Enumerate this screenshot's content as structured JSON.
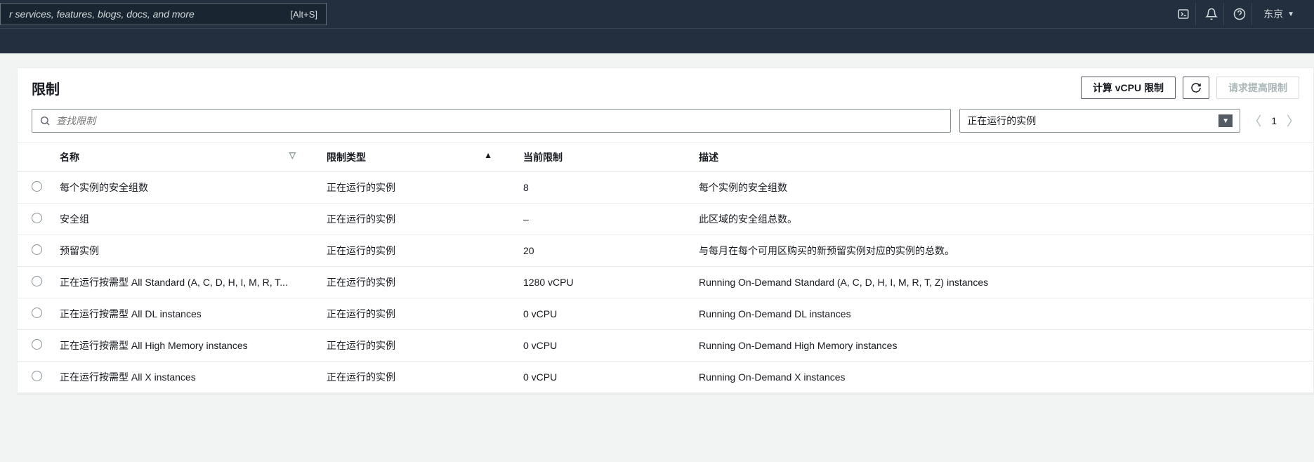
{
  "nav": {
    "search_placeholder": "r services, features, blogs, docs, and more",
    "search_hint": "[Alt+S]",
    "region": "东京"
  },
  "panel": {
    "title": "限制",
    "actions": {
      "compute_vcpu_label": "计算 vCPU 限制",
      "request_increase_label": "请求提高限制"
    }
  },
  "filter": {
    "search_placeholder": "查找限制",
    "dropdown_selected": "正在运行的实例"
  },
  "pagination": {
    "current": "1"
  },
  "table": {
    "headers": {
      "name": "名称",
      "limit_type": "限制类型",
      "current_limit": "当前限制",
      "description": "描述"
    },
    "rows": [
      {
        "name": "每个实例的安全组数",
        "limit_type": "正在运行的实例",
        "current_limit": "8",
        "description": "每个实例的安全组数"
      },
      {
        "name": "安全组",
        "limit_type": "正在运行的实例",
        "current_limit": "–",
        "description": "此区域的安全组总数。"
      },
      {
        "name": "预留实例",
        "limit_type": "正在运行的实例",
        "current_limit": "20",
        "description": "与每月在每个可用区购买的新预留实例对应的实例的总数。"
      },
      {
        "name": "正在运行按需型 All Standard (A, C, D, H, I, M, R, T...",
        "limit_type": "正在运行的实例",
        "current_limit": "1280 vCPU",
        "description": "Running On-Demand Standard (A, C, D, H, I, M, R, T, Z) instances"
      },
      {
        "name": "正在运行按需型 All DL instances",
        "limit_type": "正在运行的实例",
        "current_limit": "0 vCPU",
        "description": "Running On-Demand DL instances"
      },
      {
        "name": "正在运行按需型 All High Memory instances",
        "limit_type": "正在运行的实例",
        "current_limit": "0 vCPU",
        "description": "Running On-Demand High Memory instances"
      },
      {
        "name": "正在运行按需型 All X instances",
        "limit_type": "正在运行的实例",
        "current_limit": "0 vCPU",
        "description": "Running On-Demand X instances"
      }
    ]
  }
}
